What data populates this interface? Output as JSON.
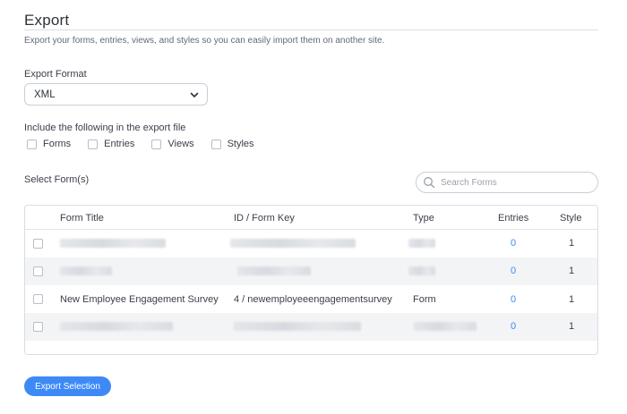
{
  "header": {
    "title": "Export",
    "subtitle": "Export your forms, entries, views, and styles so you can easily import them on another site."
  },
  "export_format": {
    "label": "Export Format",
    "selected": "XML"
  },
  "include": {
    "label": "Include the following in the export file",
    "options": [
      "Forms",
      "Entries",
      "Views",
      "Styles"
    ]
  },
  "select_forms": {
    "label": "Select Form(s)",
    "search_placeholder": "Search Forms"
  },
  "table": {
    "columns": [
      "Form Title",
      "ID / Form Key",
      "Type",
      "Entries",
      "Style"
    ],
    "rows": [
      {
        "title": "",
        "key": "",
        "type": "",
        "entries": "0",
        "style": "1",
        "redacted": true
      },
      {
        "title": "",
        "key": "",
        "type": "",
        "entries": "0",
        "style": "1",
        "redacted": true
      },
      {
        "title": "New Employee Engagement Survey",
        "key": "4 / newemployeeengagementsurvey",
        "type": "Form",
        "entries": "0",
        "style": "1",
        "redacted": false
      },
      {
        "title": "",
        "key": "",
        "type": "",
        "entries": "0",
        "style": "1",
        "redacted": true
      }
    ]
  },
  "actions": {
    "export_button": "Export Selection"
  },
  "colors": {
    "accent": "#3d8af7",
    "row_alt": "#f3f4f6"
  }
}
